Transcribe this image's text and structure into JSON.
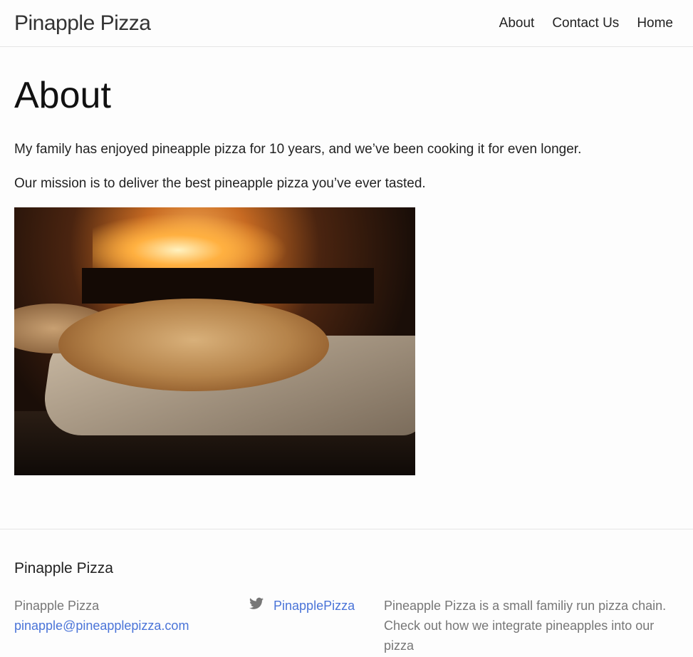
{
  "nav": {
    "brand": "Pinapple Pizza",
    "links": [
      "About",
      "Contact Us",
      "Home"
    ]
  },
  "main": {
    "title": "About",
    "paragraphs": [
      "My family has enjoyed pineapple pizza for 10 years, and we’ve been cooking it for even longer.",
      "Our mission is to deliver the best pineapple pizza you’ve ever tasted."
    ]
  },
  "footer": {
    "title": "Pinapple Pizza",
    "name": "Pinapple Pizza",
    "email": "pinapple@pineapplepizza.com",
    "twitter_icon": "twitter-icon",
    "twitter": "PinapplePizza",
    "description": "Pineapple Pizza is a small familiy run pizza chain. Check out how we integrate pineapples into our pizza"
  }
}
